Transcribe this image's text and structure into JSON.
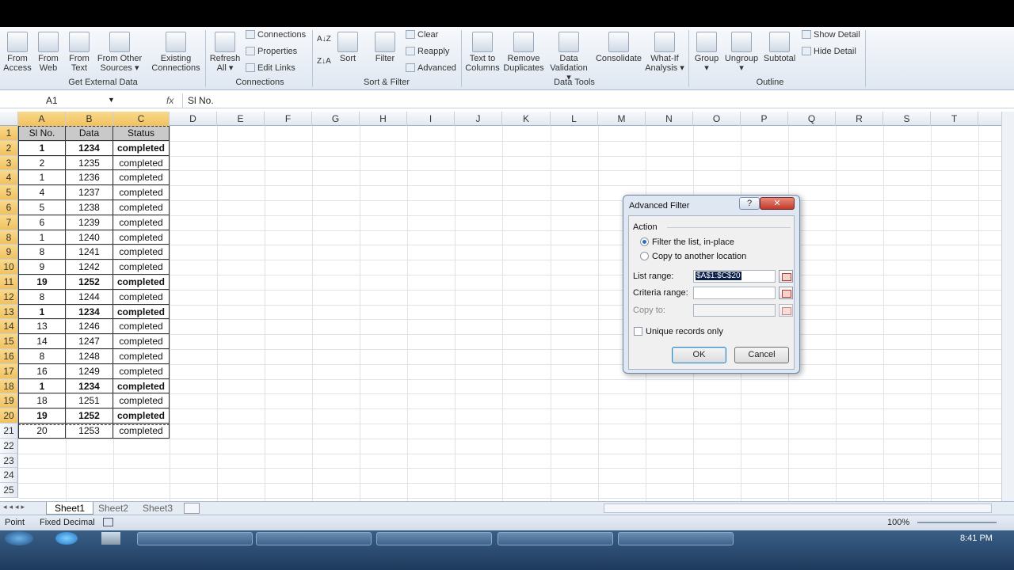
{
  "ribbon": {
    "groups": [
      {
        "label": "Get External Data",
        "buttons": [
          "From Access",
          "From Web",
          "From Text",
          "From Other Sources ▾",
          "Existing Connections"
        ]
      },
      {
        "label": "Connections",
        "refresh": "Refresh All ▾",
        "small": [
          "Connections",
          "Properties",
          "Edit Links"
        ]
      },
      {
        "label": "Sort & Filter",
        "sort": "Sort",
        "filter": "Filter",
        "small": [
          "Clear",
          "Reapply",
          "Advanced"
        ],
        "az": "A↓Z",
        "za": "Z↓A"
      },
      {
        "label": "Data Tools",
        "buttons": [
          "Text to Columns",
          "Remove Duplicates",
          "Data Validation ▾",
          "Consolidate",
          "What-If Analysis ▾"
        ]
      },
      {
        "label": "Outline",
        "buttons": [
          "Group ▾",
          "Ungroup ▾",
          "Subtotal"
        ],
        "small": [
          "Show Detail",
          "Hide Detail"
        ]
      }
    ]
  },
  "formula_bar": {
    "name_box": "A1",
    "fx": "fx",
    "content": "Sl No."
  },
  "columns": [
    "A",
    "B",
    "C",
    "D",
    "E",
    "F",
    "G",
    "H",
    "I",
    "J",
    "K",
    "L",
    "M",
    "N",
    "O",
    "P",
    "Q",
    "R",
    "S",
    "T"
  ],
  "rows": [
    "1",
    "2",
    "3",
    "4",
    "5",
    "6",
    "7",
    "8",
    "9",
    "10",
    "11",
    "12",
    "13",
    "14",
    "15",
    "16",
    "17",
    "18",
    "19",
    "20",
    "21",
    "22",
    "23",
    "24",
    "25"
  ],
  "table": {
    "headers": [
      "Sl No.",
      "Data",
      "Status"
    ],
    "data": [
      [
        "1",
        "1234",
        "completed"
      ],
      [
        "2",
        "1235",
        "completed"
      ],
      [
        "1",
        "1236",
        "completed"
      ],
      [
        "4",
        "1237",
        "completed"
      ],
      [
        "5",
        "1238",
        "completed"
      ],
      [
        "6",
        "1239",
        "completed"
      ],
      [
        "1",
        "1240",
        "completed"
      ],
      [
        "8",
        "1241",
        "completed"
      ],
      [
        "9",
        "1242",
        "completed"
      ],
      [
        "19",
        "1252",
        "completed"
      ],
      [
        "8",
        "1244",
        "completed"
      ],
      [
        "1",
        "1234",
        "completed"
      ],
      [
        "13",
        "1246",
        "completed"
      ],
      [
        "14",
        "1247",
        "completed"
      ],
      [
        "8",
        "1248",
        "completed"
      ],
      [
        "16",
        "1249",
        "completed"
      ],
      [
        "1",
        "1234",
        "completed"
      ],
      [
        "18",
        "1251",
        "completed"
      ],
      [
        "19",
        "1252",
        "completed"
      ],
      [
        "20",
        "1253",
        "completed"
      ]
    ],
    "bold_rows": [
      0,
      9,
      11,
      16,
      18
    ]
  },
  "sheets": [
    "Sheet1",
    "Sheet2",
    "Sheet3"
  ],
  "status": {
    "mode": "Point",
    "fixed": "Fixed Decimal",
    "zoom": "100%"
  },
  "taskbar": {
    "items": [
      "",
      "",
      "",
      "",
      "",
      ""
    ],
    "time": "8:41 PM"
  },
  "dialog": {
    "title": "Advanced Filter",
    "help": "?",
    "close": "✕",
    "action_label": "Action",
    "radio1": "Filter the list, in-place",
    "radio2": "Copy to another location",
    "list_range_label": "List range:",
    "list_range_value": "$A$1:$C$20",
    "criteria_label": "Criteria range:",
    "copy_to_label": "Copy to:",
    "unique_label": "Unique records only",
    "ok": "OK",
    "cancel": "Cancel"
  }
}
